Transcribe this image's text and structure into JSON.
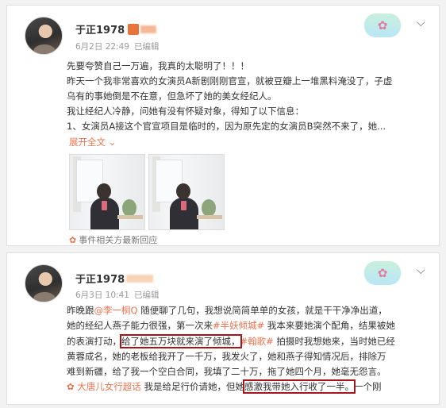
{
  "post1": {
    "author": "于正1978",
    "date": "6月2日 22:49",
    "edited": "已编辑",
    "lines": [
      "先要夸赞自己一万遍，我真的太聪明了！！！",
      "昨天一个我非常喜欢的女演员A新剧刚刚官宣，就被豆瓣上一堆黑料淹没了，子虚",
      "乌有的事她倒是不在意，但急坏了她的美女经纪人。",
      "我让经纪人冷静，问她有没有怀疑对象，得知了以下信息：",
      "1、女演员A接这个官宣项目是临时的，因为原先定的女演员B突然不来了，她..."
    ],
    "expand": "展开全文",
    "expand_icon": "chevron-down",
    "related": "事件相关方最新回应",
    "related_icon": "flower"
  },
  "post2": {
    "author": "于正1978",
    "date": "6月3日 10:41",
    "edited": "已编辑",
    "l1_a": "昨晚跟",
    "l1_mention": "@李一桐Q",
    "l1_b": " 随便聊了几句，我想说简简单单的女孩，就是干干净净出道，",
    "l2_a": "她的经纪人燕子能力很强，第一次来",
    "l2_tag": "#半妖倾城#",
    "l2_b": " 我本来要她演个配角，结果被她",
    "l3_a": "的表演打动，",
    "l3_mark": "给了她五万块就来演了倾城，",
    "l3_tag": "#翰歌#",
    "l3_b": " 拍摄时我想她来，当时她已经",
    "l4": "黄蓉成名，她的老板给我开了一千万，我发火了，她和燕子得知情况后，排除万",
    "l5": "难到新疆，给了我一个空白合同，我填了二十万，拖了她四个月，她毫无怨言。",
    "l6_tag": "大唐儿女行超话",
    "l6_a": " 我是给足行价请她，但她",
    "l6_mark": "感激我带她入行收了一半。",
    "l6_b": "一个刚"
  }
}
